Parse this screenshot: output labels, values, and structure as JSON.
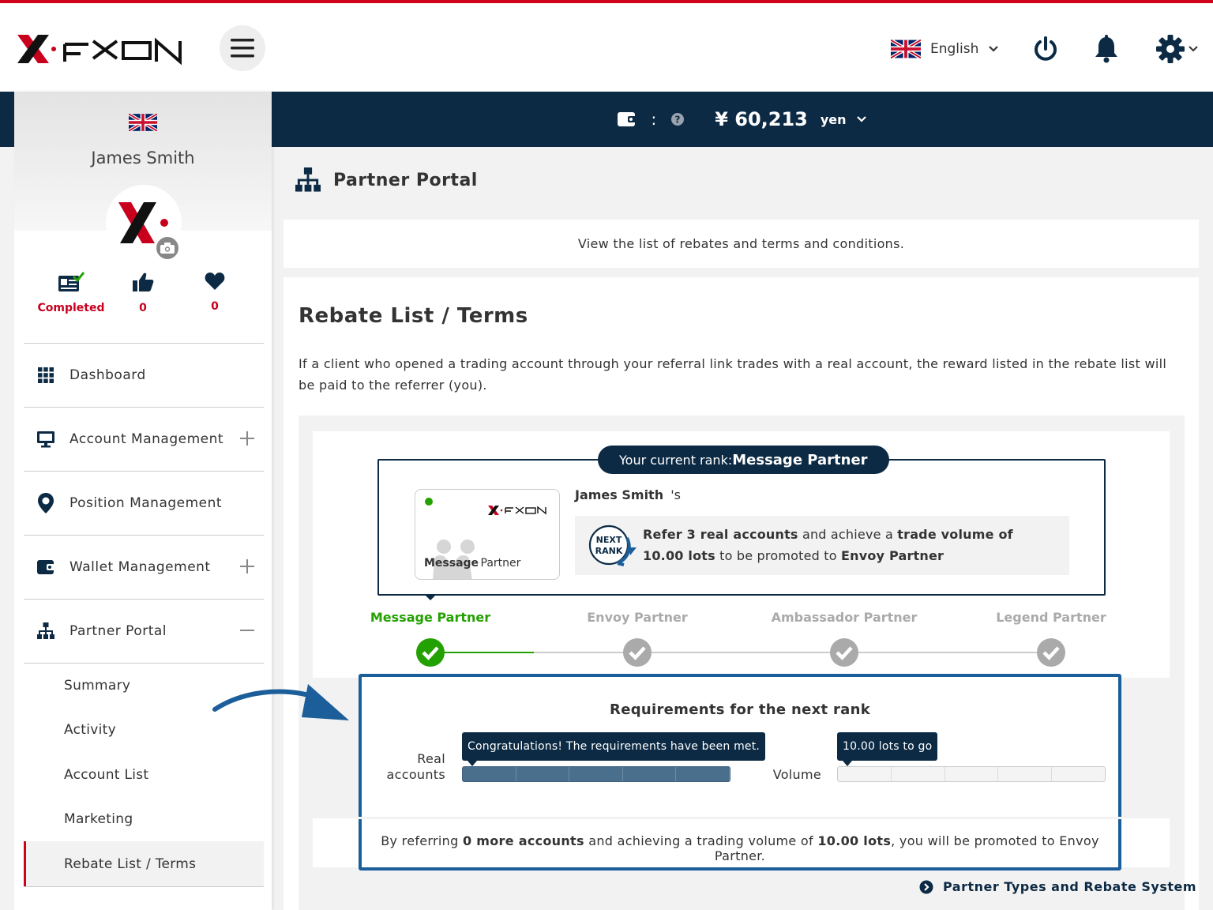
{
  "header": {
    "brand": "FXON",
    "language": "English",
    "icons": [
      "hamburger-icon",
      "uk-flag-icon",
      "chevron-down-icon",
      "power-icon",
      "bell-icon",
      "gear-icon"
    ]
  },
  "balance": {
    "separator": ":",
    "currency_symbol": "¥",
    "amount": "60,213",
    "unit": "yen"
  },
  "profile": {
    "name": "James Smith",
    "stats": [
      {
        "icon": "id-card-check-icon",
        "value": "Completed"
      },
      {
        "icon": "thumbs-up-icon",
        "value": "0"
      },
      {
        "icon": "heart-icon",
        "value": "0"
      }
    ]
  },
  "sidebar": {
    "items": [
      {
        "label": "Dashboard",
        "icon": "grid-icon"
      },
      {
        "label": "Account Management",
        "icon": "monitor-icon",
        "toggle": "+"
      },
      {
        "label": "Position Management",
        "icon": "map-pin-icon"
      },
      {
        "label": "Wallet Management",
        "icon": "wallet-icon",
        "toggle": "+"
      },
      {
        "label": "Partner Portal",
        "icon": "org-chart-icon",
        "toggle": "−"
      }
    ],
    "subitems": [
      "Summary",
      "Activity",
      "Account List",
      "Marketing",
      "Rebate List / Terms"
    ],
    "active_subitem": "Rebate List / Terms"
  },
  "page": {
    "title": "Partner Portal",
    "info": "View the list of rebates and terms and conditions.",
    "section_title": "Rebate List / Terms",
    "section_desc": "If a client who opened a trading account through your referral link trades with a real account, the reward listed in the rebate list will be paid to the referrer (you)."
  },
  "rank": {
    "current_label": "Your current rank:",
    "current_value": "Message Partner",
    "card_brand": "FXON",
    "card_rank_word": "Message",
    "card_rank_suffix": "Partner",
    "owner_name": "James Smith",
    "owner_suffix": "'s",
    "next_badge_line1": "NEXT",
    "next_badge_line2": "RANK",
    "next_text": {
      "p1": "Refer 3 real accounts",
      "p2": " and achieve a ",
      "p3": "trade volume of 10.00 lots",
      "p4": " to be promoted to ",
      "p5": "Envoy Partner"
    },
    "steps": [
      {
        "label": "Message Partner",
        "active": true
      },
      {
        "label": "Envoy Partner",
        "active": false
      },
      {
        "label": "Ambassador Partner",
        "active": false
      },
      {
        "label": "Legend Partner",
        "active": false
      }
    ]
  },
  "requirements": {
    "title": "Requirements for the next rank",
    "real_accounts_label_1": "Real",
    "real_accounts_label_2": "accounts",
    "real_accounts_tip": "Congratulations! The requirements have been met.",
    "real_accounts_progress": 1.0,
    "volume_label": "Volume",
    "volume_tip": "10.00 lots to go",
    "volume_progress": 0.0,
    "footer": {
      "p1": "By referring ",
      "p2": "0 more accounts",
      "p3": " and achieving a trading volume of ",
      "p4": "10.00 lots",
      "p5": ", you will be promoted to Envoy Partner."
    }
  },
  "footer_link": "Partner Types and Rebate System",
  "colors": {
    "navy": "#0c2a44",
    "brand_red": "#d0021b",
    "active_green": "#23a100",
    "highlight_blue": "#1b5e99"
  }
}
